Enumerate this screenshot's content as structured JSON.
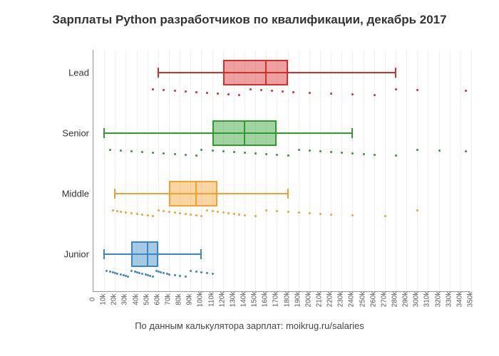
{
  "title": "Зарплаты Python разработчиков по квалификации, декабрь 2017",
  "xlabel": "По данным калькулятора зарплат: moikrug.ru/salaries",
  "chart_data": {
    "type": "box",
    "xlim": [
      0,
      350000
    ],
    "xticks": [
      0,
      10000,
      20000,
      30000,
      40000,
      50000,
      60000,
      70000,
      80000,
      90000,
      100000,
      110000,
      120000,
      130000,
      140000,
      150000,
      160000,
      170000,
      180000,
      190000,
      200000,
      210000,
      220000,
      230000,
      240000,
      250000,
      260000,
      270000,
      280000,
      290000,
      300000,
      310000,
      320000,
      330000,
      340000,
      350000
    ],
    "xtick_labels": [
      "0",
      "10k",
      "20k",
      "30k",
      "40k",
      "50k",
      "60k",
      "70k",
      "80k",
      "90k",
      "100k",
      "110k",
      "120k",
      "130k",
      "140k",
      "150k",
      "160k",
      "170k",
      "180k",
      "190k",
      "200k",
      "210k",
      "220k",
      "230k",
      "240k",
      "250k",
      "260k",
      "270k",
      "280k",
      "290k",
      "300k",
      "310k",
      "320k",
      "330k",
      "340k",
      "350k"
    ],
    "categories": [
      "Junior",
      "Middle",
      "Senior",
      "Lead"
    ],
    "series": [
      {
        "name": "Junior",
        "color": "#3a87c7",
        "fill": "rgba(58,135,199,0.45)",
        "min": 10000,
        "q1": 35000,
        "median": 50000,
        "q3": 60000,
        "max": 100000
      },
      {
        "name": "Middle",
        "color": "#f0a12f",
        "fill": "rgba(240,161,47,0.45)",
        "min": 20000,
        "q1": 70000,
        "median": 95000,
        "q3": 115000,
        "max": 180000
      },
      {
        "name": "Senior",
        "color": "#2e9b2e",
        "fill": "rgba(46,155,46,0.45)",
        "min": 10000,
        "q1": 110000,
        "median": 140000,
        "q3": 170000,
        "max": 240000
      },
      {
        "name": "Lead",
        "color": "#d42d2d",
        "fill": "rgba(212,45,45,0.45)",
        "min": 60000,
        "q1": 120000,
        "median": 160000,
        "q3": 180000,
        "max": 280000
      }
    ],
    "jitter": {
      "Junior": [
        12,
        15,
        18,
        20,
        22,
        25,
        28,
        30,
        32,
        35,
        38,
        40,
        42,
        45,
        48,
        50,
        52,
        55,
        58,
        60,
        62,
        65,
        68,
        70,
        75,
        80,
        85,
        90,
        95,
        100,
        105,
        110
      ],
      "Middle": [
        18,
        22,
        25,
        30,
        35,
        40,
        45,
        50,
        55,
        60,
        65,
        70,
        75,
        80,
        85,
        90,
        95,
        100,
        105,
        110,
        115,
        120,
        125,
        130,
        135,
        140,
        150,
        160,
        170,
        180,
        190,
        200,
        210,
        220,
        240,
        270,
        300
      ],
      "Senior": [
        15,
        25,
        35,
        45,
        55,
        65,
        75,
        85,
        95,
        100,
        110,
        120,
        130,
        140,
        150,
        160,
        170,
        180,
        190,
        200,
        210,
        220,
        230,
        240,
        250,
        260,
        280,
        300,
        320,
        345
      ],
      "Lead": [
        55,
        65,
        75,
        85,
        95,
        105,
        115,
        125,
        135,
        145,
        155,
        165,
        175,
        185,
        200,
        220,
        240,
        260,
        280,
        300,
        345
      ]
    }
  }
}
